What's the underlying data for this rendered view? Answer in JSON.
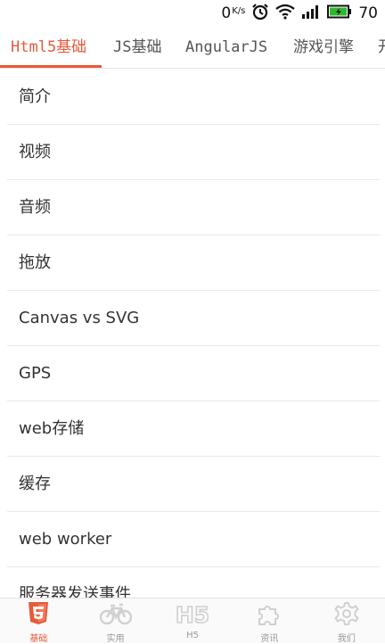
{
  "status_bar": {
    "speed_value": "0",
    "speed_unit": "K/s",
    "battery_level": "70",
    "battery_color": "#2eb82e"
  },
  "tabs": [
    {
      "label": "Html5基础",
      "active": true
    },
    {
      "label": "JS基础",
      "active": false
    },
    {
      "label": "AngularJS",
      "active": false
    },
    {
      "label": "游戏引擎",
      "active": false
    },
    {
      "label": "开",
      "active": false
    }
  ],
  "accent_color": "#e9593c",
  "list": {
    "items": [
      "简介",
      "视频",
      "音频",
      "拖放",
      "Canvas vs SVG",
      "GPS",
      "web存储",
      "缓存",
      "web worker",
      "服务器发送事件"
    ]
  },
  "bottom_nav": {
    "items": [
      {
        "label": "基础",
        "icon": "html5-icon",
        "active": true
      },
      {
        "label": "实用",
        "icon": "bicycle-icon",
        "active": false
      },
      {
        "label": "H5",
        "icon": "h5-text-icon",
        "active": false
      },
      {
        "label": "资讯",
        "icon": "puzzle-icon",
        "active": false
      },
      {
        "label": "我们",
        "icon": "gear-icon",
        "active": false
      }
    ]
  }
}
